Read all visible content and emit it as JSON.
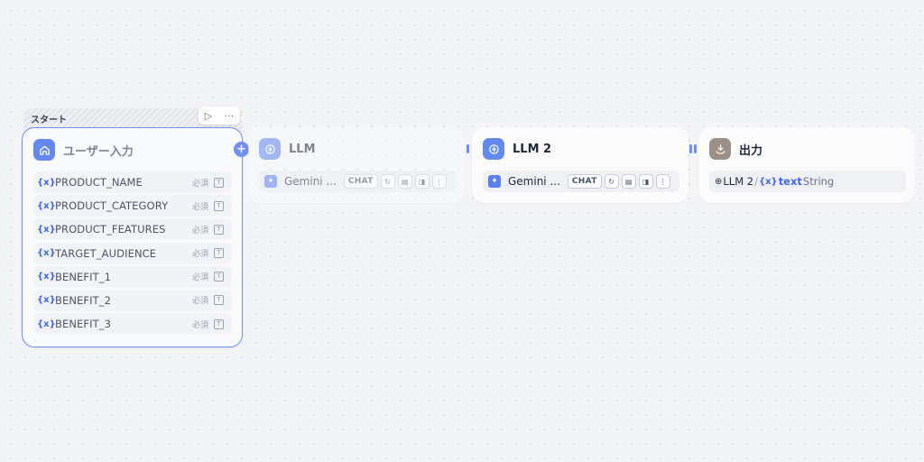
{
  "start_tab": {
    "label": "スタート",
    "run_icon": "play-icon",
    "more_icon": "more-icon"
  },
  "nodes": {
    "start": {
      "title": "ユーザー入力",
      "icon": "home-icon",
      "variables": [
        {
          "icon": "{x}",
          "name": "PRODUCT_NAME",
          "required": "必須",
          "type_icon": "text-type-icon"
        },
        {
          "icon": "{x}",
          "name": "PRODUCT_CATEGORY",
          "required": "必須",
          "type_icon": "text-type-icon"
        },
        {
          "icon": "{x}",
          "name": "PRODUCT_FEATURES",
          "required": "必須",
          "type_icon": "text-type-icon"
        },
        {
          "icon": "{x}",
          "name": "TARGET_AUDIENCE",
          "required": "必須",
          "type_icon": "text-type-icon"
        },
        {
          "icon": "{x}",
          "name": "BENEFIT_1",
          "required": "必須",
          "type_icon": "text-type-icon"
        },
        {
          "icon": "{x}",
          "name": "BENEFIT_2",
          "required": "必須",
          "type_icon": "text-type-icon"
        },
        {
          "icon": "{x}",
          "name": "BENEFIT_3",
          "required": "必須",
          "type_icon": "text-type-icon"
        }
      ]
    },
    "llm1": {
      "title": "LLM",
      "model": "Gemini ...",
      "mode": "CHAT"
    },
    "llm2": {
      "title": "LLM 2",
      "model": "Gemini ...",
      "mode": "CHAT"
    },
    "output": {
      "title": "出力",
      "source": "LLM 2",
      "separator": "/",
      "var_icon": "{x}",
      "var_name": "text",
      "var_type": "String"
    }
  },
  "colors": {
    "accent": "#6f8ff2",
    "icon_blue": "#6388f0",
    "icon_brown": "#9b8f86",
    "variable_blue": "#3f67e6"
  }
}
